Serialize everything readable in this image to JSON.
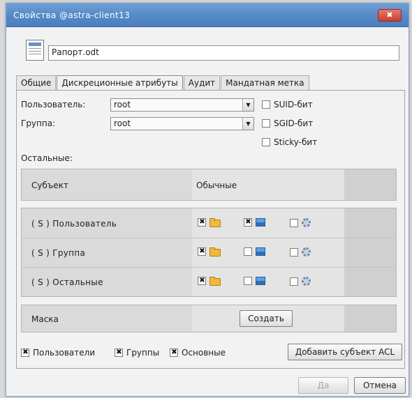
{
  "window": {
    "title": "Свойства @astra-client13",
    "close_glyph": "✖"
  },
  "file": {
    "name": "Рапорт.odt",
    "icon": "document-icon"
  },
  "tabs": [
    {
      "label": "Общие"
    },
    {
      "label": "Дискреционные атрибуты"
    },
    {
      "label": "Аудит"
    },
    {
      "label": "Мандатная метка"
    }
  ],
  "owner": {
    "user_label": "Пользователь:",
    "user_value": "root",
    "group_label": "Группа:",
    "group_value": "root",
    "dropdown_glyph": "▼"
  },
  "special_bits": [
    {
      "label": "SUID-бит",
      "checked": false
    },
    {
      "label": "SGID-бит",
      "checked": false
    },
    {
      "label": "Sticky-бит",
      "checked": false
    }
  ],
  "others_label": "Остальные:",
  "acl_header": {
    "subject": "Субъект",
    "column": "Обычные"
  },
  "acl_rows": [
    {
      "label": "( S )  Пользователь",
      "read": true,
      "write": true,
      "exec": false
    },
    {
      "label": "( S )  Группа",
      "read": true,
      "write": false,
      "exec": false
    },
    {
      "label": "( S )  Остальные",
      "read": true,
      "write": false,
      "exec": false
    }
  ],
  "mask": {
    "label": "Маска",
    "create_button": "Создать"
  },
  "filters": [
    {
      "label": "Пользователи",
      "checked": true
    },
    {
      "label": "Группы",
      "checked": true
    },
    {
      "label": "Основные",
      "checked": true
    }
  ],
  "add_acl_button": "Добавить субъект ACL",
  "footer": {
    "ok_label": "Да",
    "cancel_label": "Отмена"
  }
}
